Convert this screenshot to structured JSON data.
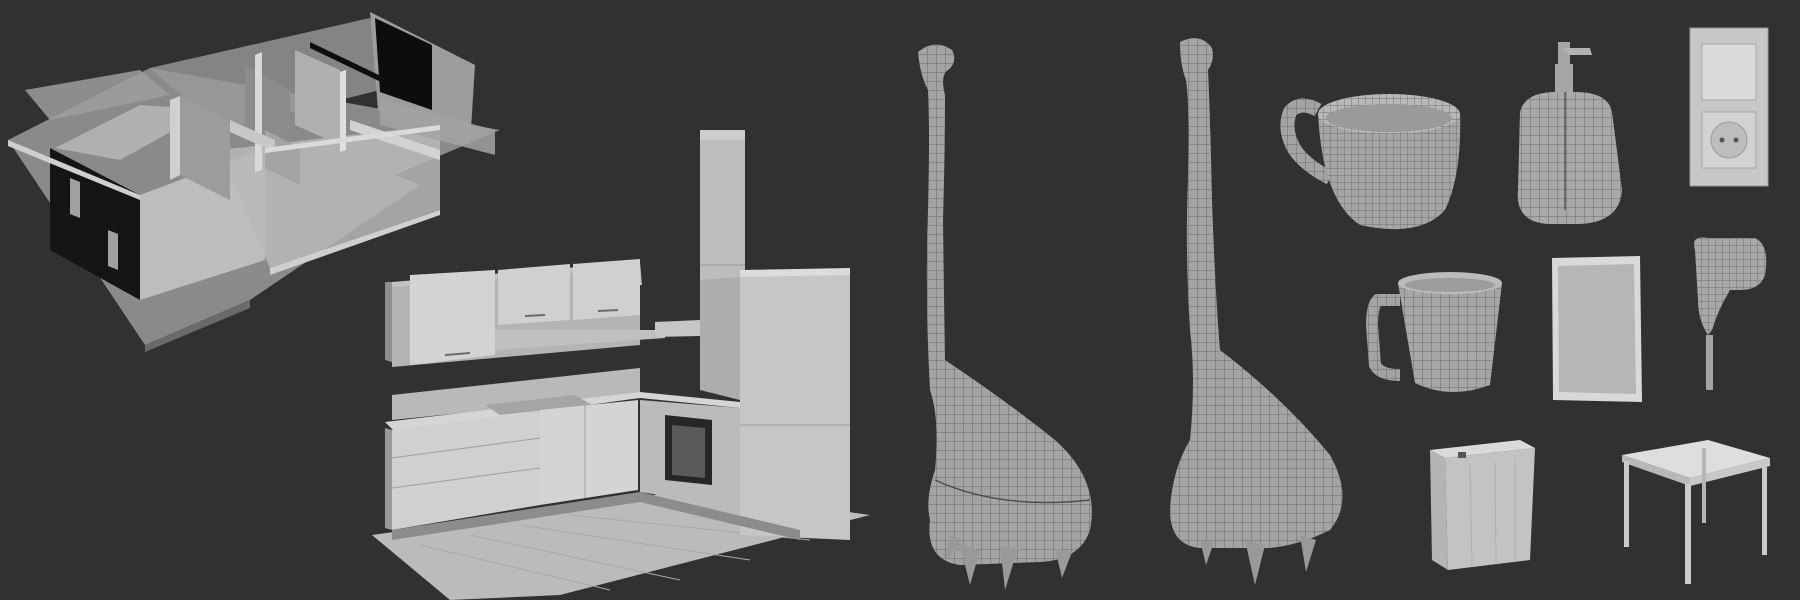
{
  "viewport": {
    "background": "#313131",
    "model_fill": "#a8a8a8",
    "model_shade": "#8a8a8a",
    "model_light": "#c4c4c4",
    "wire_color": "#5a5a5a"
  },
  "objects": [
    {
      "name": "apartment-floorplan-model",
      "kind": "architecture",
      "wireframe": false
    },
    {
      "name": "kitchen-set-model",
      "kind": "furniture",
      "wireframe": false
    },
    {
      "name": "loch-ness-ladle-front-model",
      "kind": "utensil",
      "wireframe": true
    },
    {
      "name": "loch-ness-ladle-side-model",
      "kind": "utensil",
      "wireframe": true
    },
    {
      "name": "teacup-model",
      "kind": "tableware",
      "wireframe": true
    },
    {
      "name": "mug-model",
      "kind": "tableware",
      "wireframe": true
    },
    {
      "name": "soap-dispenser-model",
      "kind": "bathroom",
      "wireframe": true
    },
    {
      "name": "light-switch-socket-model",
      "kind": "electrical",
      "wireframe": false
    },
    {
      "name": "picture-frame-model",
      "kind": "decor",
      "wireframe": false
    },
    {
      "name": "hair-dryer-model",
      "kind": "bathroom",
      "wireframe": true
    },
    {
      "name": "laundry-bin-model",
      "kind": "storage",
      "wireframe": false
    },
    {
      "name": "side-table-model",
      "kind": "furniture",
      "wireframe": false
    }
  ]
}
